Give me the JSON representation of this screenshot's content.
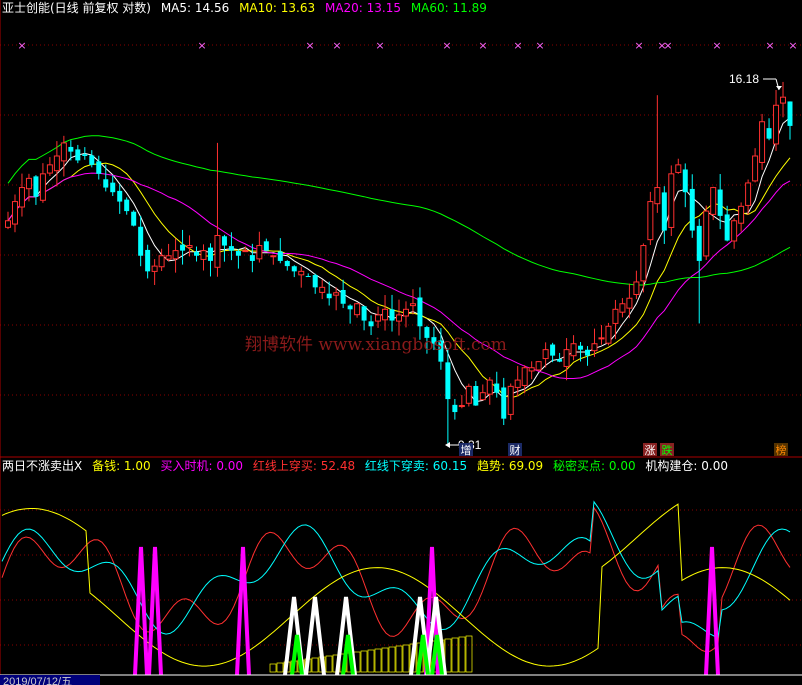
{
  "header": {
    "stock": "亚士创能(日线 前复权 对数)",
    "ma": [
      {
        "label": "MA5: 14.56",
        "color": "#ffffff"
      },
      {
        "label": "MA10: 13.63",
        "color": "#ffff00"
      },
      {
        "label": "MA20: 13.15",
        "color": "#ff00ff"
      },
      {
        "label": "MA60: 11.89",
        "color": "#00ff00"
      }
    ]
  },
  "indicator": {
    "name": "两日不涨卖出X",
    "items": [
      {
        "label": "备钱: 1.00",
        "color": "#ffff00"
      },
      {
        "label": "买入时机: 0.00",
        "color": "#ff00ff"
      },
      {
        "label": "红线上穿买: 52.48",
        "color": "#ff3030"
      },
      {
        "label": "红线下穿卖: 60.15",
        "color": "#00ffff"
      },
      {
        "label": "趋势: 69.09",
        "color": "#ffff00"
      },
      {
        "label": "秘密买点: 0.00",
        "color": "#00ff00"
      },
      {
        "label": "机构建仓: 0.00",
        "color": "#ffffff"
      }
    ]
  },
  "watermark": "翔博软件 www.xiangbosoft.com",
  "annotations": {
    "high": "16.18",
    "low": "9.31"
  },
  "event_tags": [
    {
      "text": "增",
      "color": "#ffffff",
      "bg": "#1b2a66"
    },
    {
      "text": "财",
      "color": "#ffffff",
      "bg": "#1b2a66"
    },
    {
      "text": "涨",
      "color": "#ffffff",
      "bg": "#882222"
    },
    {
      "text": "跌",
      "color": "#00ff00",
      "bg": "#882222"
    },
    {
      "text": "榜",
      "color": "#ff8800",
      "bg": "#553300"
    }
  ],
  "date_label": "2019/07/12/五",
  "colors": {
    "up": "#ff3030",
    "down": "#00ffff",
    "grid": "#8a0000"
  },
  "chart_data": {
    "type": "candlestick",
    "scale": "log",
    "price_range": [
      9.31,
      16.18
    ],
    "close": [
      13.2,
      13.6,
      13.9,
      14.1,
      13.7,
      14.2,
      14.4,
      14.6,
      14.9,
      14.7,
      14.5,
      14.6,
      14.4,
      14.2,
      13.9,
      13.8,
      13.6,
      13.4,
      13.1,
      12.5,
      12.2,
      12.3,
      12.5,
      12.5,
      12.6,
      12.6,
      12.7,
      12.5,
      12.6,
      12.4,
      12.9,
      12.7,
      12.6,
      12.5,
      12.6,
      12.4,
      12.7,
      12.6,
      12.5,
      12.4,
      12.3,
      12.2,
      12.2,
      12.1,
      11.9,
      11.9,
      11.7,
      11.8,
      11.6,
      11.5,
      11.6,
      11.3,
      11.2,
      11.4,
      11.5,
      11.3,
      11.4,
      11.5,
      11.6,
      11.2,
      11.0,
      10.9,
      10.6,
      10.0,
      9.8,
      9.9,
      10.2,
      9.9,
      10.1,
      10.3,
      10.1,
      9.7,
      10.2,
      10.3,
      10.5,
      10.5,
      10.6,
      10.8,
      10.7,
      10.6,
      10.8,
      10.9,
      10.8,
      10.7,
      10.9,
      11.0,
      11.2,
      11.5,
      11.6,
      11.7,
      12.0,
      12.7,
      13.6,
      13.9,
      13.0,
      14.2,
      14.4,
      13.8,
      13.0,
      12.4,
      13.4,
      13.9,
      13.3,
      12.8,
      13.2,
      13.5,
      14.0,
      14.6,
      15.4,
      15.0,
      15.8,
      16.0,
      15.3
    ],
    "ma": [
      {
        "name": "MA5",
        "color": "#ffffff",
        "value": 14.56
      },
      {
        "name": "MA10",
        "color": "#ffff00",
        "value": 13.63
      },
      {
        "name": "MA20",
        "color": "#ff00ff",
        "value": 13.15
      },
      {
        "name": "MA60",
        "color": "#00ff00",
        "value": 11.89
      }
    ],
    "sub_chart": {
      "name": "两日不涨卖出X",
      "series": [
        {
          "name": "红线上穿买",
          "color": "#ff3030",
          "last": 52.48
        },
        {
          "name": "红线下穿卖",
          "color": "#00ffff",
          "last": 60.15
        },
        {
          "name": "趋势",
          "color": "#ffff00",
          "last": 69.09
        }
      ],
      "signals": {
        "magenta": [
          7.5,
          8.5,
          12,
          25,
          35,
          38,
          57
        ],
        "white": [
          24,
          26,
          28,
          30,
          31,
          36,
          37
        ],
        "green": [
          24,
          30,
          35,
          36
        ]
      }
    }
  }
}
